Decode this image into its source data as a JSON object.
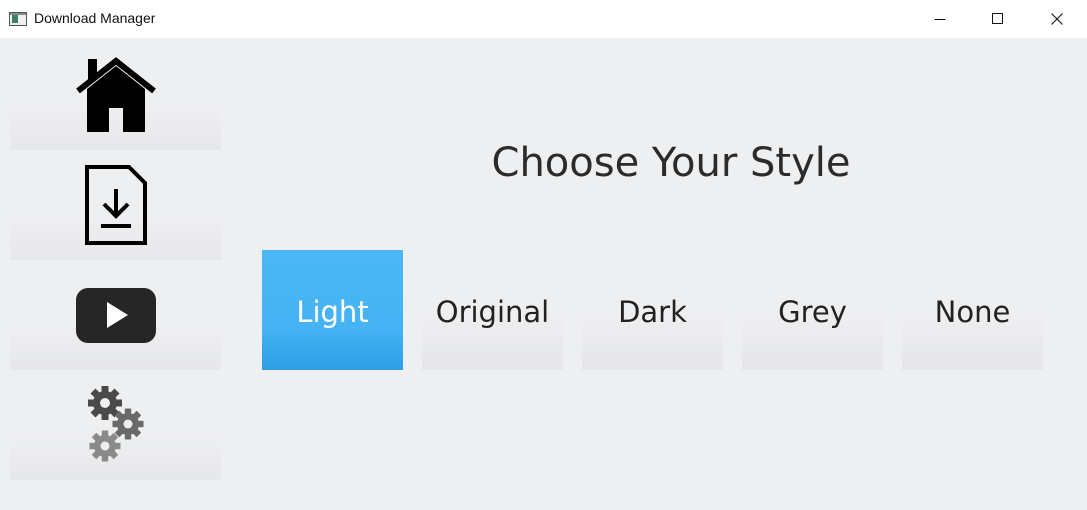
{
  "window": {
    "title": "Download Manager",
    "controls": [
      "minimize-icon",
      "maximize-icon",
      "close-icon"
    ]
  },
  "sidebar": {
    "items": [
      {
        "name": "home",
        "icon": "home-icon"
      },
      {
        "name": "download",
        "icon": "file-download-icon"
      },
      {
        "name": "youtube",
        "icon": "youtube-play-icon"
      },
      {
        "name": "settings",
        "icon": "gears-icon"
      }
    ]
  },
  "main": {
    "title": "Choose Your Style",
    "styles": [
      {
        "label": "Light",
        "selected": true
      },
      {
        "label": "Original",
        "selected": false
      },
      {
        "label": "Dark",
        "selected": false
      },
      {
        "label": "Grey",
        "selected": false
      },
      {
        "label": "None",
        "selected": false
      }
    ]
  },
  "colors": {
    "background": "#eeeff1",
    "accent": "#45b3f4",
    "titlebar": "#ffffff",
    "text": "#2b2b2b"
  }
}
